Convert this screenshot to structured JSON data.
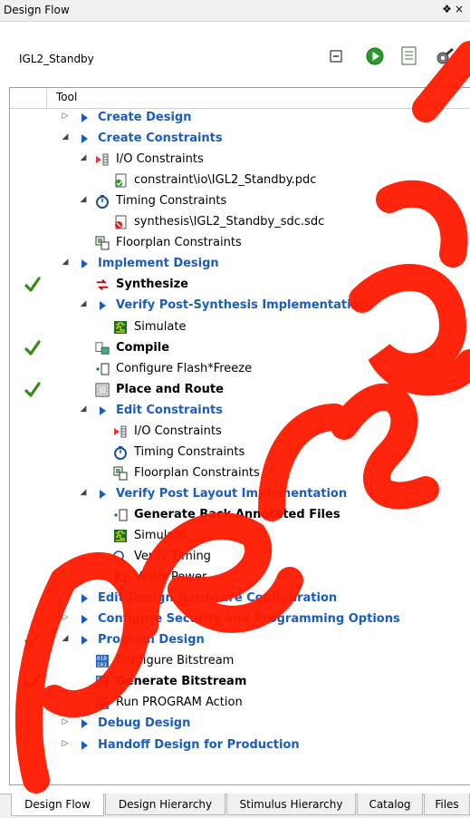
{
  "window": {
    "title": "Design Flow",
    "pin_glyph": "❖",
    "close_glyph": "×"
  },
  "project": {
    "name": "IGL2_Standby"
  },
  "toolbar": {
    "icons": [
      "collapse-all-icon",
      "run-icon",
      "report-icon",
      "options-icon"
    ]
  },
  "tree": {
    "column_header": "Tool",
    "rows": [
      {
        "label": "Create Design",
        "style": "cat",
        "expander": "closed",
        "depth": 0,
        "check": false,
        "icon": "blue-triangle"
      },
      {
        "label": "Create Constraints",
        "style": "cat",
        "expander": "open",
        "depth": 0,
        "check": false,
        "icon": "blue-triangle"
      },
      {
        "label": "I/O Constraints",
        "style": "plain",
        "expander": "open",
        "depth": 1,
        "check": false,
        "icon": "io"
      },
      {
        "label": "constraint\\io\\IGL2_Standby.pdc",
        "style": "plain",
        "expander": "none",
        "depth": 2,
        "check": false,
        "icon": "file-ok"
      },
      {
        "label": "Timing Constraints",
        "style": "plain",
        "expander": "open",
        "depth": 1,
        "check": false,
        "icon": "stopwatch"
      },
      {
        "label": "synthesis\\IGL2_Standby_sdc.sdc",
        "style": "plain",
        "expander": "none",
        "depth": 2,
        "check": false,
        "icon": "file-bad"
      },
      {
        "label": "Floorplan Constraints",
        "style": "plain",
        "expander": "none",
        "depth": 1,
        "check": false,
        "icon": "floorplan"
      },
      {
        "label": "Implement Design",
        "style": "cat",
        "expander": "open",
        "depth": 0,
        "check": false,
        "icon": "blue-triangle"
      },
      {
        "label": "Synthesize",
        "style": "bold",
        "expander": "none",
        "depth": 1,
        "check": true,
        "icon": "synth"
      },
      {
        "label": "Verify Post-Synthesis Implementation",
        "style": "cat",
        "expander": "open",
        "depth": 1,
        "check": false,
        "icon": "blue-triangle"
      },
      {
        "label": "Simulate",
        "style": "plain",
        "expander": "none",
        "depth": 2,
        "check": false,
        "icon": "sim"
      },
      {
        "label": "Compile",
        "style": "bold",
        "expander": "none",
        "depth": 1,
        "check": true,
        "icon": "compile"
      },
      {
        "label": "Configure Flash*Freeze",
        "style": "plain",
        "expander": "none",
        "depth": 1,
        "check": false,
        "icon": "config"
      },
      {
        "label": "Place and Route",
        "style": "bold",
        "expander": "none",
        "depth": 1,
        "check": true,
        "icon": "par"
      },
      {
        "label": "Edit Constraints",
        "style": "cat",
        "expander": "open",
        "depth": 1,
        "check": false,
        "icon": "blue-triangle"
      },
      {
        "label": "I/O Constraints",
        "style": "plain",
        "expander": "none",
        "depth": 2,
        "check": false,
        "icon": "io"
      },
      {
        "label": "Timing Constraints",
        "style": "plain",
        "expander": "none",
        "depth": 2,
        "check": false,
        "icon": "stopwatch"
      },
      {
        "label": "Floorplan Constraints",
        "style": "plain",
        "expander": "none",
        "depth": 2,
        "check": false,
        "icon": "floorplan"
      },
      {
        "label": "Verify Post Layout Implementation",
        "style": "cat",
        "expander": "open",
        "depth": 1,
        "check": false,
        "icon": "blue-triangle"
      },
      {
        "label": "Generate Back Annotated Files",
        "style": "bold",
        "expander": "none",
        "depth": 2,
        "check": false,
        "icon": "config"
      },
      {
        "label": "Simulate",
        "style": "plain",
        "expander": "none",
        "depth": 2,
        "check": false,
        "icon": "sim"
      },
      {
        "label": "Verify Timing",
        "style": "plain",
        "expander": "none",
        "depth": 2,
        "check": false,
        "icon": "verify-timing"
      },
      {
        "label": "Verify Power",
        "style": "plain",
        "expander": "none",
        "depth": 2,
        "check": false,
        "icon": "verify-power"
      },
      {
        "label": "Edit Design Hardware Configuration",
        "style": "cat",
        "expander": "closed",
        "depth": 0,
        "check": false,
        "icon": "blue-triangle"
      },
      {
        "label": "Configure Security and Programming Options",
        "style": "cat",
        "expander": "closed",
        "depth": 0,
        "check": false,
        "icon": "blue-triangle"
      },
      {
        "label": "Program Design",
        "style": "cat",
        "expander": "open",
        "depth": 0,
        "check": true,
        "icon": "blue-triangle"
      },
      {
        "label": "Configure Bitstream",
        "style": "plain",
        "expander": "none",
        "depth": 1,
        "check": false,
        "icon": "bitstream"
      },
      {
        "label": "Generate Bitstream",
        "style": "bold",
        "expander": "none",
        "depth": 1,
        "check": true,
        "icon": "bitstream"
      },
      {
        "label": "Run PROGRAM Action",
        "style": "plain",
        "expander": "none",
        "depth": 1,
        "check": false,
        "icon": "bitstream"
      },
      {
        "label": "Debug Design",
        "style": "cat",
        "expander": "closed",
        "depth": 0,
        "check": false,
        "icon": "blue-triangle"
      },
      {
        "label": "Handoff Design for Production",
        "style": "cat",
        "expander": "closed",
        "depth": 0,
        "check": false,
        "icon": "blue-triangle"
      }
    ]
  },
  "tabs": [
    {
      "label": "Design Flow",
      "active": true
    },
    {
      "label": "Design Hierarchy",
      "active": false
    },
    {
      "label": "Stimulus Hierarchy",
      "active": false
    },
    {
      "label": "Catalog",
      "active": false
    },
    {
      "label": "Files",
      "active": false
    }
  ],
  "colors": {
    "category_text": "#1a5dbf",
    "check_green": "#3a8a1a",
    "run_green": "#2a9a2a",
    "watermark_red": "#ff1a00"
  }
}
